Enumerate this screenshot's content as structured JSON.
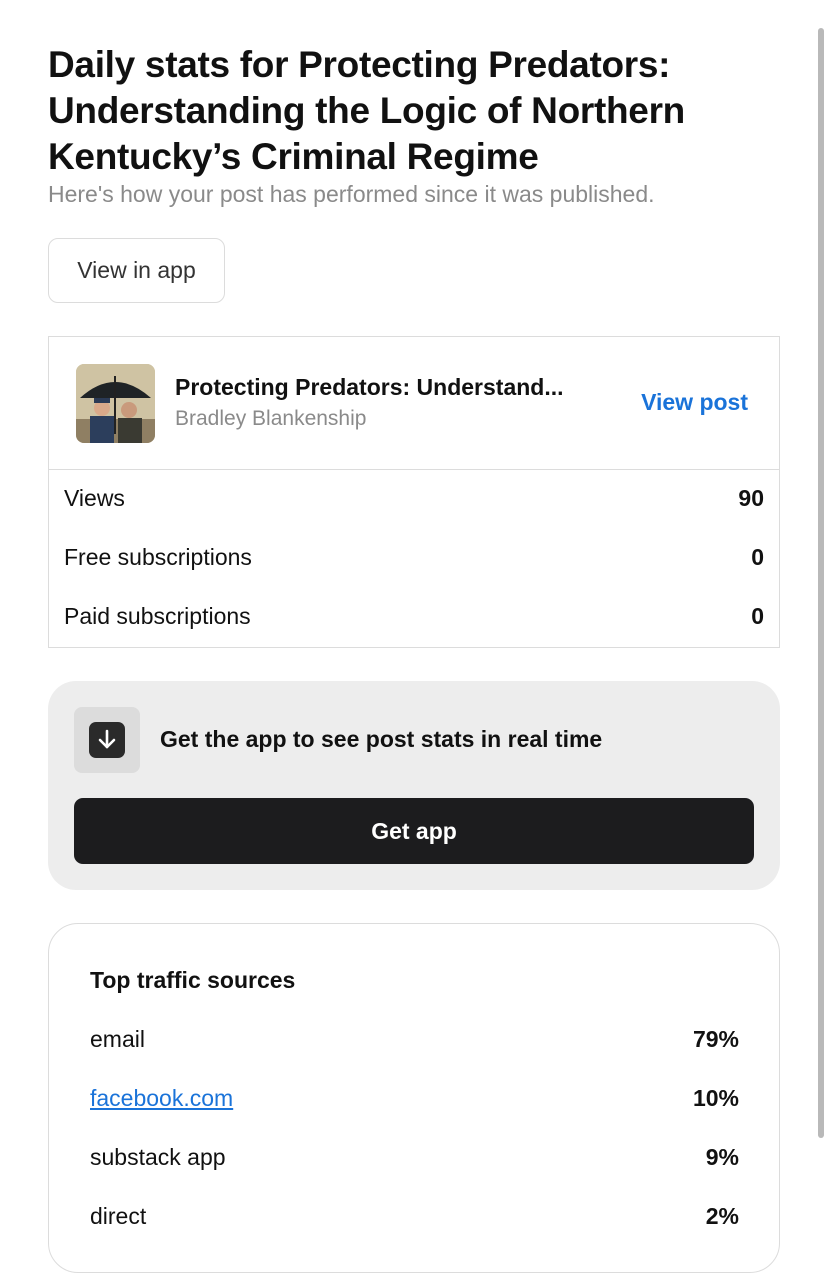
{
  "page": {
    "title": "Daily stats for Protecting Predators: Understanding the Logic of Northern Kentucky’s Criminal Regime",
    "subtitle": "Here's how your post has performed since it was published.",
    "view_in_app_label": "View in app"
  },
  "post": {
    "title": "Protecting Predators: Understand...",
    "author": "Bradley Blankenship",
    "view_post_label": "View post",
    "thumbnail_icon": "post-thumbnail-illustration"
  },
  "stats": [
    {
      "label": "Views",
      "value": "90"
    },
    {
      "label": "Free subscriptions",
      "value": "0"
    },
    {
      "label": "Paid subscriptions",
      "value": "0"
    }
  ],
  "app_promo": {
    "icon": "download-icon",
    "text": "Get the app to see post stats in real time",
    "button_label": "Get app"
  },
  "traffic": {
    "title": "Top traffic sources",
    "rows": [
      {
        "label": "email",
        "value": "79%",
        "link": false
      },
      {
        "label": "facebook.com",
        "value": "10%",
        "link": true
      },
      {
        "label": "substack app",
        "value": "9%",
        "link": false
      },
      {
        "label": "direct",
        "value": "2%",
        "link": false
      }
    ]
  },
  "colors": {
    "link": "#1a73d9",
    "button_dark": "#1c1c1e",
    "panel_bg": "#ededed"
  }
}
